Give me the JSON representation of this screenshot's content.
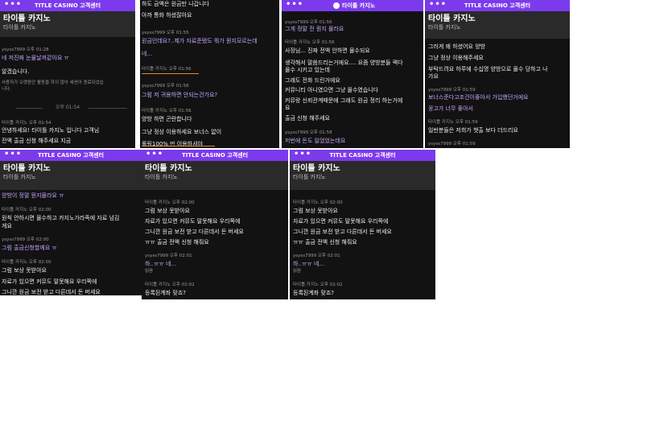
{
  "topbar_title": "TITLE CASINO 고객센터",
  "brand": "타이틀 카지노",
  "chat_sub": "타이틀 카지노",
  "dots": "•••",
  "accent_color": "#7c3aed",
  "panels": {
    "p1": {
      "lines": [
        "ysyss7999 오후 01:28",
        "네 저진짜 눈물날꺼같아요 ㅠ",
        "알겠습니다.",
        "사용자가 오랫동안 활동을 하지 않아 세션이 종료되었습",
        "니다.",
        "오후 01:54",
        "타이틀 카지노 오후 01:54",
        "안녕하세요! 타이틀 카지노 입니다 고객님",
        "전액 출금 신청 해주세요 지금"
      ]
    },
    "p2": {
      "lines": [
        "하도 금액은 원금만 나갑니다",
        "아까 통화 하셨잖아요",
        "ysyss7999 오후 01:55",
        "원금인데요?..제가 자료준됐도 뭐가 뭔지모르는데",
        "네...",
        "타이틀 카지노 오후 01:56",
        "ysyss7999 오후 01:56",
        "그럼 저 귀용하면 안되는건가요?",
        "타이틀 카지노 오후 01:56",
        "양방 하면 곤란합니다",
        "그냥 정상 이용하세요 보너스 없이",
        "롤링100% 만 이용하셔야"
      ]
    },
    "p3": {
      "lines": [
        "타이틀 카지노",
        "ysyss7999 오후 01:56",
        "그게 정말 전 뭔지 몰라요",
        "타이틀 카지노 오후 01:56",
        "사장님... 진짜 전액 안하면 몰수되요",
        "생각해서 말씀드리는거에요.... 요즘 양방분들 렉다",
        "몰수 시키고 있는데",
        "그래도 전화 드린거에요",
        "커뮤니티 아니였으면 그냥 몰수였습니다",
        "커뮤랑 신뢰관계때문에 그래도 원금 정리 하는거에",
        "요",
        "출금 신청 해주세요",
        "ysyss7999 오후 01:58",
        "저번에 돈도 잃었었는데요"
      ]
    },
    "p4": {
      "lines": [
        "타이틀 카지노",
        "타이틀 카지노",
        "그러게 왜 하셨어요 양방",
        "그냥 정상 이용해주세요",
        "부탁드려요 하루에 수십명 양방으로 몰수 당하고 나",
        "가요",
        "ysyss7999 오후 01:59",
        "보너스준다고조건이좋아서 가입했던거에요",
        "꽁고가 너무 좋아서",
        "타이틀 카지노 오후 01:59",
        "일반분들은 저희가 챗출 보다 더드리요",
        "ysyss7999 오후 01:59"
      ]
    },
    "p5": {
      "lines": [
        "양방이 정말 뭔지몰라요 ㅠ",
        "타이틀 카지노 오후 02:00",
        "원칙 안하시면 몰수하고 카지노가라족에 자료 넘김",
        "게요",
        "ysyss7999 오후 02:00",
        "그럼 출금신청할께요 ㅠ",
        "타이틀 카지노 오후 02:00",
        "그럼 보상 못받아요",
        "자료가 있으면 커뮤도 말못해요 우리쪽에",
        "그니깐 원금 보전 받고 다른데서 돈 버세요"
      ]
    },
    "p6": {
      "lines": [
        "타이틀 카지노 오후 02:00",
        "그럼 보상 못받아요",
        "자료가 있으면 커뮤도 말못해요 우리쪽에",
        "그니깐 원금 보전 받고 다른데서 돈 버세요",
        "ㅠㅠ 출금 전액 신청 해줘요",
        "ysyss7999 오후 02:01",
        "하..ㅠㅠ 네...",
        "읽음",
        "타이틀 카지노 오후 02:02",
        "등록된계좌 맞죠?"
      ]
    }
  }
}
